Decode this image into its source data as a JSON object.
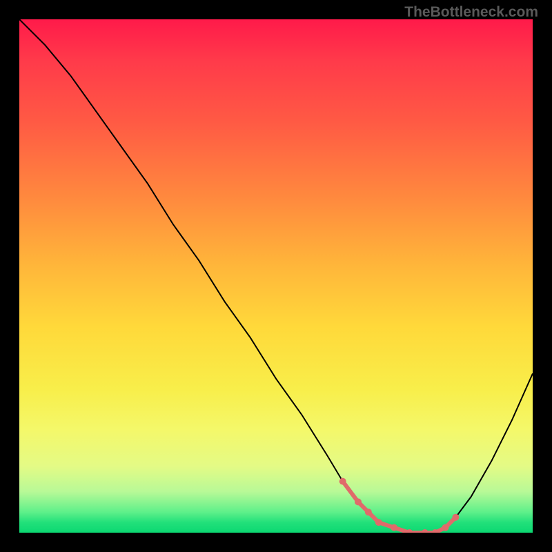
{
  "watermark": "TheBottleneck.com",
  "chart_data": {
    "type": "line",
    "title": "",
    "xlabel": "",
    "ylabel": "",
    "xlim": [
      0,
      100
    ],
    "ylim": [
      0,
      100
    ],
    "series": [
      {
        "name": "bottleneck-curve",
        "x": [
          0,
          5,
          10,
          15,
          20,
          25,
          30,
          35,
          40,
          45,
          50,
          55,
          60,
          63,
          66,
          68,
          70,
          73,
          76,
          79,
          81,
          83,
          85,
          88,
          92,
          96,
          100
        ],
        "y": [
          100,
          95,
          89,
          82,
          75,
          68,
          60,
          53,
          45,
          38,
          30,
          23,
          15,
          10,
          6,
          4,
          2,
          1,
          0,
          0,
          0,
          1,
          3,
          7,
          14,
          22,
          31
        ]
      }
    ],
    "markers": {
      "name": "optimal-range",
      "x": [
        63,
        66,
        68,
        70,
        73,
        76,
        79,
        81,
        83,
        85
      ],
      "y": [
        10,
        6,
        4,
        2,
        1,
        0,
        0,
        0,
        1,
        3
      ]
    },
    "background": "rainbow-vertical-gradient"
  }
}
